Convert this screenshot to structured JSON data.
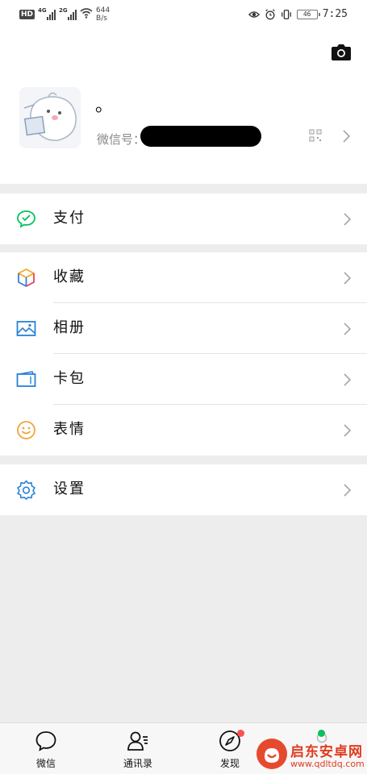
{
  "status_bar": {
    "hd_badge": "HD",
    "net_1": "4G",
    "net_2": "2G",
    "speed_value": "644",
    "speed_unit": "B/s",
    "battery": "46",
    "time": "7:25",
    "icons": [
      "eye-comfort-icon",
      "alarm-icon",
      "vibrate-icon",
      "battery-icon",
      "wifi-icon"
    ]
  },
  "profile": {
    "nickname": "。",
    "wechat_id_label": "微信号：",
    "wechat_id_value": "",
    "icons": [
      "camera-icon",
      "qr-code-icon",
      "chevron-right-icon"
    ]
  },
  "menu": {
    "pay": {
      "label": "支付",
      "icon": "wechat-pay-icon",
      "color": "#07c160"
    },
    "favorites": {
      "label": "收藏",
      "icon": "favorites-cube-icon"
    },
    "album": {
      "label": "相册",
      "icon": "photo-album-icon",
      "color": "#2782d7"
    },
    "cards": {
      "label": "卡包",
      "icon": "card-wallet-icon",
      "color": "#2782d7"
    },
    "stickers": {
      "label": "表情",
      "icon": "emoji-smile-icon",
      "color": "#f0a53a"
    },
    "settings": {
      "label": "设置",
      "icon": "gear-icon",
      "color": "#2782d7"
    }
  },
  "tabbar": {
    "tabs": [
      {
        "label": "微信",
        "icon": "chat-bubble-icon"
      },
      {
        "label": "通讯录",
        "icon": "contacts-icon"
      },
      {
        "label": "发现",
        "icon": "compass-icon",
        "badge": "red-dot"
      },
      {
        "label": "",
        "icon": "me-icon",
        "badge": "green-dot"
      }
    ]
  },
  "watermark": {
    "title": "启东安卓网",
    "url": "www.qdltdq.com"
  },
  "colors": {
    "background": "#ededed",
    "accent_green": "#07c160",
    "badge_red": "#fa5151",
    "icon_blue": "#2782d7"
  }
}
